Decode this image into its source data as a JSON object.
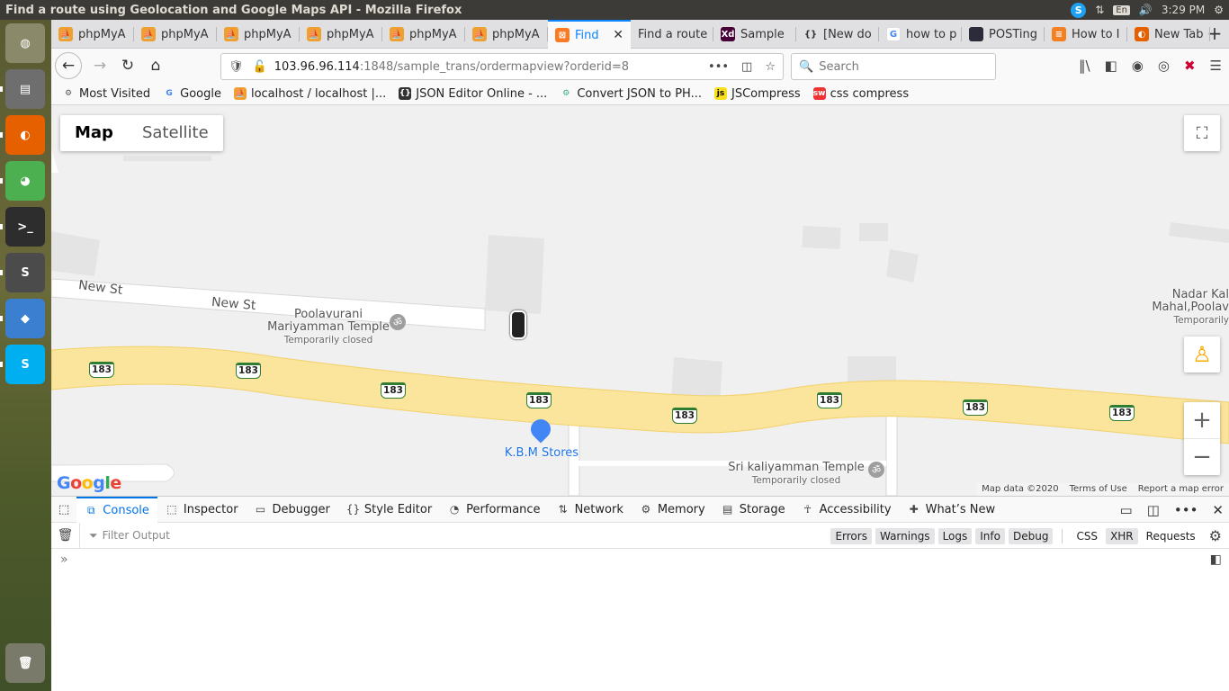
{
  "window": {
    "title": "Find a route using Geolocation and Google Maps API - Mozilla Firefox"
  },
  "tray": {
    "lang": "En",
    "time": "3:29 PM",
    "skype": "S"
  },
  "launcher": [
    {
      "name": "ubuntu-dash-icon",
      "color": "#8a8a6a"
    },
    {
      "name": "files-icon",
      "color": "#6e6e6e"
    },
    {
      "name": "firefox-icon",
      "color": "#e66000"
    },
    {
      "name": "chrome-icon",
      "color": "#4caf50"
    },
    {
      "name": "terminal-icon",
      "color": "#2d2d2d"
    },
    {
      "name": "sublime-icon",
      "color": "#4b4b4b"
    },
    {
      "name": "virtualbox-icon",
      "color": "#3a7fd0"
    },
    {
      "name": "skype-icon",
      "color": "#00aff0"
    },
    {
      "name": "trash-icon",
      "color": "#7a7a6a"
    }
  ],
  "tabs": [
    {
      "label": "phpMyA",
      "fav": "pma"
    },
    {
      "label": "phpMyA",
      "fav": "pma"
    },
    {
      "label": "phpMyA",
      "fav": "pma"
    },
    {
      "label": "phpMyA",
      "fav": "pma"
    },
    {
      "label": "phpMyA",
      "fav": "pma"
    },
    {
      "label": "phpMyA",
      "fav": "pma"
    },
    {
      "label": "Find",
      "fav": "xampp",
      "active": true
    },
    {
      "label": "Find a route",
      "fav": "none"
    },
    {
      "label": "Sample",
      "fav": "xd"
    },
    {
      "label": "[New do",
      "fav": "json"
    },
    {
      "label": "how to p",
      "fav": "google"
    },
    {
      "label": "POSTing",
      "fav": "dark"
    },
    {
      "label": "How to I",
      "fav": "so"
    },
    {
      "label": "New Tab",
      "fav": "firefox"
    }
  ],
  "nav": {
    "url_host": "103.96.96.114",
    "url_path": ":1848/sample_trans/ordermapview?orderid=8",
    "search_placeholder": "Search"
  },
  "bookmarks": [
    {
      "label": "Most Visited",
      "icon": "gear-icon"
    },
    {
      "label": "Google",
      "icon": "google-icon"
    },
    {
      "label": "localhost / localhost |...",
      "icon": "pma-icon"
    },
    {
      "label": "JSON Editor Online - ...",
      "icon": "json-icon"
    },
    {
      "label": "Convert JSON to PH...",
      "icon": "convert-icon"
    },
    {
      "label": "JSCompress",
      "icon": "js-icon"
    },
    {
      "label": "css compress",
      "icon": "sw-icon"
    }
  ],
  "map": {
    "type_map": "Map",
    "type_satellite": "Satellite",
    "streets": [
      "New St",
      "New St"
    ],
    "temple_name": "Poolavurani Mariyamman Temple",
    "temple_status": "Temporarily closed",
    "store_name": "K.B.M Stores",
    "sk_temple_name": "Sri kaliyamman Temple",
    "sk_temple_status": "Temporarily closed",
    "nadar_name": "Nadar Kal Mahal,Poolav",
    "nadar_status": "Temporarily",
    "highway": "183",
    "attribution": [
      "Map data ©2020",
      "Terms of Use",
      "Report a map error"
    ],
    "google_logo": "Google"
  },
  "devtools": {
    "tabs": [
      {
        "label": "Console",
        "icon": "console-icon",
        "active": true
      },
      {
        "label": "Inspector",
        "icon": "inspector-icon"
      },
      {
        "label": "Debugger",
        "icon": "debugger-icon"
      },
      {
        "label": "Style Editor",
        "icon": "style-editor-icon"
      },
      {
        "label": "Performance",
        "icon": "performance-icon"
      },
      {
        "label": "Network",
        "icon": "network-icon"
      },
      {
        "label": "Memory",
        "icon": "memory-icon"
      },
      {
        "label": "Storage",
        "icon": "storage-icon"
      },
      {
        "label": "Accessibility",
        "icon": "accessibility-icon"
      },
      {
        "label": "What’s New",
        "icon": "whats-new-icon"
      }
    ],
    "filter_placeholder": "Filter Output",
    "levels": [
      "Errors",
      "Warnings",
      "Logs",
      "Info",
      "Debug"
    ],
    "extra": [
      "CSS",
      "XHR",
      "Requests"
    ],
    "prompt": "»"
  }
}
